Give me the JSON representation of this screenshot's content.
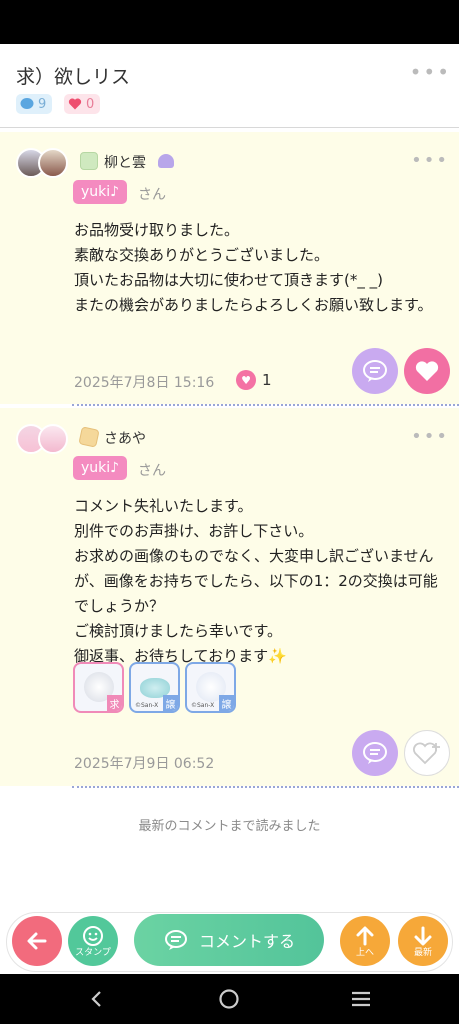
{
  "header": {
    "title": "求）欲しリス",
    "comment_count": "9",
    "like_count": "0"
  },
  "comments": [
    {
      "username": "柳と雲",
      "reply_to": "yuki♪",
      "honorific": "さん",
      "body": "お品物受け取りました。\n素敵な交換ありがとうございました。\n頂いたお品物は大切に使わせて頂きます(*_ _)\nまたの機会がありましたらよろしくお願い致します。",
      "date": "2025年7月8日 15:16",
      "likes": "1"
    },
    {
      "username": "さあや",
      "reply_to": "yuki♪",
      "honorific": "さん",
      "body": "コメント失礼いたします。\n別件でのお声掛け、お許し下さい。\nお求めの画像のものでなく、大変申し訳ございませんが、画像をお持ちでしたら、以下の1：2の交換は可能でしょうか？\nご検討頂けましたら幸いです。\n御返事、お待ちしております✨",
      "stamps": [
        {
          "tag": "求"
        },
        {
          "tag": "譲",
          "credit": "©San-X"
        },
        {
          "tag": "譲",
          "credit": "©San-X"
        }
      ],
      "date": "2025年7月9日 06:52"
    }
  ],
  "footer": {
    "read_all": "最新のコメントまで読みました",
    "stamp_label": "スタンプ",
    "comment_label": "コメントする",
    "up_label": "上へ",
    "latest_label": "最新"
  },
  "colors": {
    "comment_bg": "#fefde8",
    "pink": "#f26fa3",
    "green": "#53c49a",
    "orange": "#f6a839",
    "purple": "#c9aaf0"
  }
}
